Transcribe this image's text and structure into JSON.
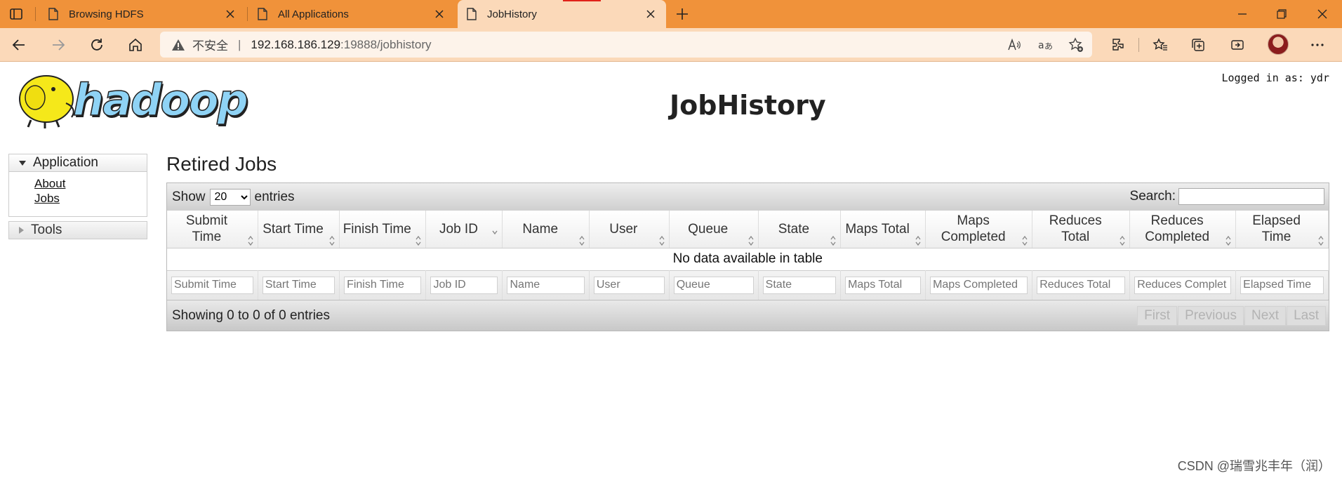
{
  "browser": {
    "tabs": [
      {
        "title": "Browsing HDFS"
      },
      {
        "title": "All Applications"
      },
      {
        "title": "JobHistory"
      }
    ],
    "address": {
      "insecure_label": "不安全",
      "separator": "|",
      "url_host": "192.168.186.129",
      "url_rest": ":19888/jobhistory"
    }
  },
  "page": {
    "logged_in": "Logged in as: ydr",
    "title": "JobHistory",
    "logo_text": "hadoop"
  },
  "nav": {
    "application": {
      "label": "Application",
      "links": [
        {
          "label": "About"
        },
        {
          "label": "Jobs"
        }
      ]
    },
    "tools": {
      "label": "Tools"
    }
  },
  "main": {
    "section_title": "Retired Jobs",
    "length": {
      "show": "Show",
      "value": "20",
      "entries": "entries"
    },
    "search_label": "Search:",
    "columns": [
      "Submit Time",
      "Start Time",
      "Finish Time",
      "Job ID",
      "Name",
      "User",
      "Queue",
      "State",
      "Maps Total",
      "Maps Completed",
      "Reduces Total",
      "Reduces Completed",
      "Elapsed Time"
    ],
    "filter_placeholders": [
      "Submit Time",
      "Start Time",
      "Finish Time",
      "Job ID",
      "Name",
      "User",
      "Queue",
      "State",
      "Maps Total",
      "Maps Completed",
      "Reduces Total",
      "Reduces Complet",
      "Elapsed Time"
    ],
    "empty_message": "No data available in table",
    "info": "Showing 0 to 0 of 0 entries",
    "pager": [
      "First",
      "Previous",
      "Next",
      "Last"
    ]
  },
  "watermark": "CSDN @瑞雪兆丰年（润）"
}
